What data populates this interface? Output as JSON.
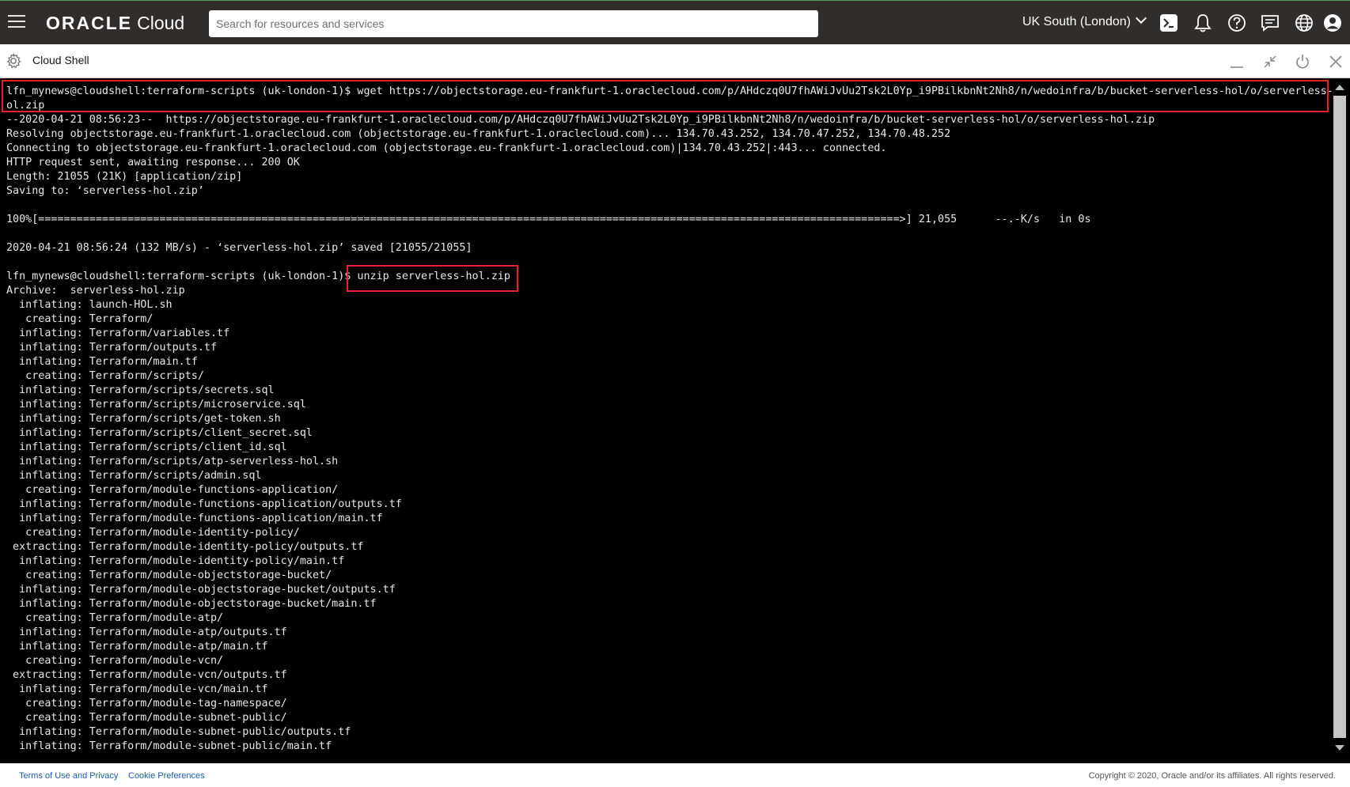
{
  "header": {
    "logo_brand": "ORACLE",
    "logo_product": "Cloud",
    "search_placeholder": "Search for resources and services",
    "region": "UK South (London)",
    "icons": [
      "hamburger-menu-icon",
      "cloud-shell-icon",
      "bell-icon",
      "help-icon",
      "chat-icon",
      "globe-icon",
      "user-avatar-icon"
    ],
    "colors": {
      "header_bg": "#312d2a",
      "highlight_red": "#e4232c",
      "link_blue": "#1a5bab"
    }
  },
  "shell": {
    "title": "Cloud Shell",
    "controls": [
      "minimize-icon",
      "restore-icon",
      "restart-icon",
      "close-icon"
    ]
  },
  "terminal": {
    "lines": [
      "lfn_mynews@cloudshell:terraform-scripts (uk-london-1)$ wget https://objectstorage.eu-frankfurt-1.oraclecloud.com/p/AHdczq0U7fhAWiJvUu2Tsk2L0Yp_i9PBilkbnNt2Nh8/n/wedoinfra/b/bucket-serverless-hol/o/serverless-h",
      "ol.zip",
      "--2020-04-21 08:56:23--  https://objectstorage.eu-frankfurt-1.oraclecloud.com/p/AHdczq0U7fhAWiJvUu2Tsk2L0Yp_i9PBilkbnNt2Nh8/n/wedoinfra/b/bucket-serverless-hol/o/serverless-hol.zip",
      "Resolving objectstorage.eu-frankfurt-1.oraclecloud.com (objectstorage.eu-frankfurt-1.oraclecloud.com)... 134.70.43.252, 134.70.47.252, 134.70.48.252",
      "Connecting to objectstorage.eu-frankfurt-1.oraclecloud.com (objectstorage.eu-frankfurt-1.oraclecloud.com)|134.70.43.252|:443... connected.",
      "HTTP request sent, awaiting response... 200 OK",
      "Length: 21055 (21K) [application/zip]",
      "Saving to: ‘serverless-hol.zip’",
      "",
      "100%[=======================================================================================================================================>] 21,055      --.-K/s   in 0s",
      "",
      "2020-04-21 08:56:24 (132 MB/s) - ‘serverless-hol.zip’ saved [21055/21055]",
      "",
      "lfn_mynews@cloudshell:terraform-scripts (uk-london-1)$ unzip serverless-hol.zip",
      "Archive:  serverless-hol.zip",
      "  inflating: launch-HOL.sh",
      "   creating: Terraform/",
      "  inflating: Terraform/variables.tf",
      "  inflating: Terraform/outputs.tf",
      "  inflating: Terraform/main.tf",
      "   creating: Terraform/scripts/",
      "  inflating: Terraform/scripts/secrets.sql",
      "  inflating: Terraform/scripts/microservice.sql",
      "  inflating: Terraform/scripts/get-token.sh",
      "  inflating: Terraform/scripts/client_secret.sql",
      "  inflating: Terraform/scripts/client_id.sql",
      "  inflating: Terraform/scripts/atp-serverless-hol.sh",
      "  inflating: Terraform/scripts/admin.sql",
      "   creating: Terraform/module-functions-application/",
      "  inflating: Terraform/module-functions-application/outputs.tf",
      "  inflating: Terraform/module-functions-application/main.tf",
      "   creating: Terraform/module-identity-policy/",
      " extracting: Terraform/module-identity-policy/outputs.tf",
      "  inflating: Terraform/module-identity-policy/main.tf",
      "   creating: Terraform/module-objectstorage-bucket/",
      "  inflating: Terraform/module-objectstorage-bucket/outputs.tf",
      "  inflating: Terraform/module-objectstorage-bucket/main.tf",
      "   creating: Terraform/module-atp/",
      "  inflating: Terraform/module-atp/outputs.tf",
      "  inflating: Terraform/module-atp/main.tf",
      "   creating: Terraform/module-vcn/",
      " extracting: Terraform/module-vcn/outputs.tf",
      "  inflating: Terraform/module-vcn/main.tf",
      "   creating: Terraform/module-tag-namespace/",
      "   creating: Terraform/module-subnet-public/",
      "  inflating: Terraform/module-subnet-public/outputs.tf",
      "  inflating: Terraform/module-subnet-public/main.tf"
    ]
  },
  "footer": {
    "terms": "Terms of Use and Privacy",
    "cookies": "Cookie Preferences",
    "copyright": "Copyright © 2020, Oracle and/or its affiliates. All rights reserved."
  }
}
